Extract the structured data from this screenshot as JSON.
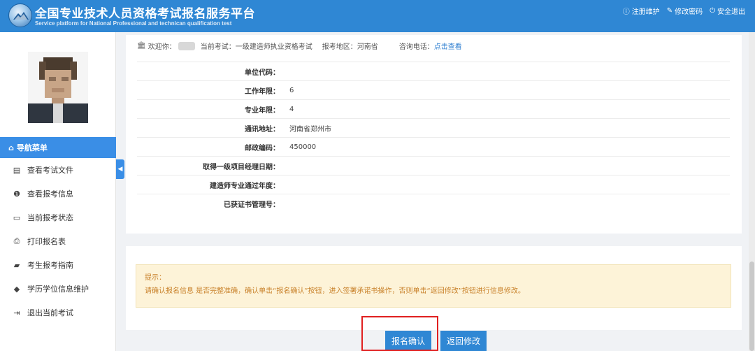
{
  "header": {
    "title_cn": "全国专业技术人员资格考试报名服务平台",
    "title_en": "Service platform for National Professional and technican qualification test",
    "links": [
      {
        "label": "注册维护",
        "icon": "info-icon"
      },
      {
        "label": "修改密码",
        "icon": "edit-icon"
      },
      {
        "label": "安全退出",
        "icon": "power-icon"
      }
    ]
  },
  "sidebar": {
    "nav_header": "导航菜单",
    "items": [
      {
        "label": "查看考试文件",
        "icon": "document-icon"
      },
      {
        "label": "查看报考信息",
        "icon": "info-circle-icon"
      },
      {
        "label": "当前报考状态",
        "icon": "monitor-icon"
      },
      {
        "label": "打印报名表",
        "icon": "printer-icon"
      },
      {
        "label": "考生报考指南",
        "icon": "book-icon"
      },
      {
        "label": "学历学位信息维护",
        "icon": "graduation-cap-icon"
      },
      {
        "label": "退出当前考试",
        "icon": "sign-out-icon"
      }
    ]
  },
  "info_bar": {
    "welcome": "欢迎你：",
    "current_exam": "当前考试：一级建造师执业资格考试",
    "region": "报考地区：河南省",
    "consult_phone": "咨询电话：",
    "consult_link": "点击查看"
  },
  "form": {
    "rows": [
      {
        "label": "单位代码：",
        "value": ""
      },
      {
        "label": "工作年限：",
        "value": "6"
      },
      {
        "label": "专业年限：",
        "value": "4"
      },
      {
        "label": "通讯地址：",
        "value": "河南省郑州市"
      },
      {
        "label": "邮政编码：",
        "value": "450000"
      },
      {
        "label": "取得一级项目经理日期：",
        "value": ""
      },
      {
        "label": "建造师专业通过年度：",
        "value": ""
      },
      {
        "label": "已获证书管理号：",
        "value": ""
      }
    ]
  },
  "notice": {
    "title": "提示：",
    "text": "请确认报名信息 是否完整准确，确认单击“报名确认”按钮，进入签署承诺书操作，否则单击“返回修改”按钮进行信息修改。"
  },
  "buttons": {
    "confirm": "报名确认",
    "back": "返回修改"
  },
  "colors": {
    "header_bg": "#2f87d4",
    "accent": "#3a8ee6",
    "notice_bg": "#fdf3d8",
    "notice_text": "#c9822b",
    "highlight": "#e02020"
  }
}
